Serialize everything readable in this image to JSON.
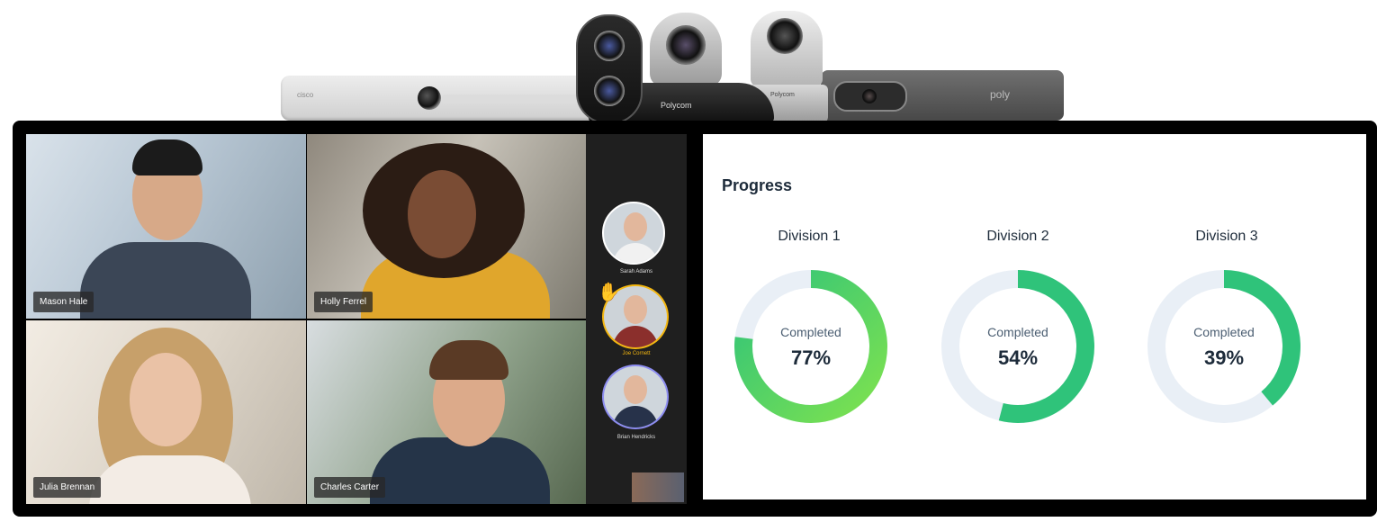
{
  "hardware": {
    "left_bar_brand": "cisco",
    "ptz_brand": "Polycom",
    "ptz2_brand": "Polycom",
    "right_bar_brand": "poly"
  },
  "video_grid": {
    "participants": [
      {
        "name": "Mason Hale"
      },
      {
        "name": "Holly Ferrel"
      },
      {
        "name": "Julia Brennan"
      },
      {
        "name": "Charles Carter"
      }
    ]
  },
  "sidebar": {
    "participants": [
      {
        "name": "Sarah Adams",
        "raised_hand": false
      },
      {
        "name": "Joe Cornett",
        "raised_hand": true
      },
      {
        "name": "Brian Hendricks",
        "raised_hand": false
      }
    ],
    "hand_icon": "raised-hand-icon"
  },
  "progress": {
    "title": "Progress",
    "divisions": [
      {
        "name": "Division 1",
        "label": "Completed",
        "value": 77,
        "display": "77%"
      },
      {
        "name": "Division 2",
        "label": "Completed",
        "value": 54,
        "display": "54%"
      },
      {
        "name": "Division 3",
        "label": "Completed",
        "value": 39,
        "display": "39%"
      }
    ],
    "colors": {
      "track": "#e9eff6",
      "fill_start": "#2fc37a",
      "fill_end": "#7ee24f",
      "title": "#1d2b3a"
    }
  }
}
